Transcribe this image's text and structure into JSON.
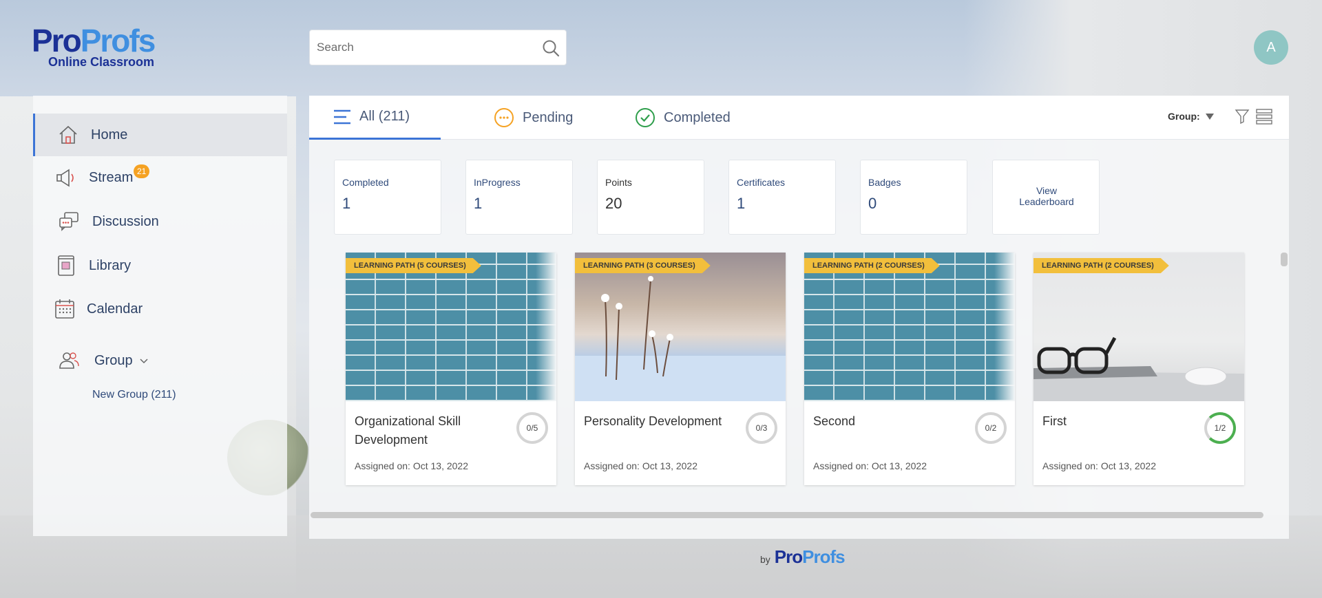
{
  "brand": {
    "logo_word_a": "Pro",
    "logo_word_b": "Profs",
    "subtitle": "Online Classroom"
  },
  "search": {
    "placeholder": "Search"
  },
  "user": {
    "avatar_initial": "A"
  },
  "sidebar": {
    "items": [
      {
        "label": "Home",
        "icon": "home-icon",
        "active": true
      },
      {
        "label": "Stream",
        "icon": "megaphone-icon",
        "badge": "21"
      },
      {
        "label": "Discussion",
        "icon": "chat-icon"
      },
      {
        "label": "Library",
        "icon": "book-icon"
      },
      {
        "label": "Calendar",
        "icon": "calendar-icon"
      },
      {
        "label": "Group",
        "icon": "users-icon"
      }
    ],
    "subgroup": "New Group (211)"
  },
  "tabs": [
    {
      "label": "All (211)",
      "icon": "menu-icon",
      "active": true
    },
    {
      "label": "Pending",
      "icon": "pending-icon"
    },
    {
      "label": "Completed",
      "icon": "check-circle-icon"
    }
  ],
  "toolbar": {
    "group_label": "Group:"
  },
  "stats": [
    {
      "label": "Completed",
      "value": "1"
    },
    {
      "label": "InProgress",
      "value": "1"
    },
    {
      "label": "Points",
      "value": "20"
    },
    {
      "label": "Certificates",
      "value": "1"
    },
    {
      "label": "Badges",
      "value": "0"
    }
  ],
  "leaderboard": {
    "line1": "View",
    "line2": "Leaderboard"
  },
  "cards": [
    {
      "ribbon": "LEARNING PATH (5 COURSES)",
      "title": "Organizational Skill Development",
      "progress": "0/5",
      "date": "Assigned on: Oct 13, 2022"
    },
    {
      "ribbon": "LEARNING PATH (3 COURSES)",
      "title": "Personality Development",
      "progress": "0/3",
      "date": "Assigned on: Oct 13, 2022"
    },
    {
      "ribbon": "LEARNING PATH (2 COURSES)",
      "title": "Second",
      "progress": "0/2",
      "date": "Assigned on: Oct 13, 2022"
    },
    {
      "ribbon": "LEARNING PATH (2 COURSES)",
      "title": "First",
      "progress": "1/2",
      "date": "Assigned on: Oct 13, 2022"
    }
  ],
  "footer": {
    "by": "by",
    "logo_a": "Pro",
    "logo_b": "Profs"
  },
  "colors": {
    "brand_dark": "#1b3196",
    "brand_light": "#3f8fe0",
    "accent": "#3c74d6",
    "badge": "#f5a223",
    "ribbon": "#f2bf3c",
    "progress": "#4caf50"
  }
}
